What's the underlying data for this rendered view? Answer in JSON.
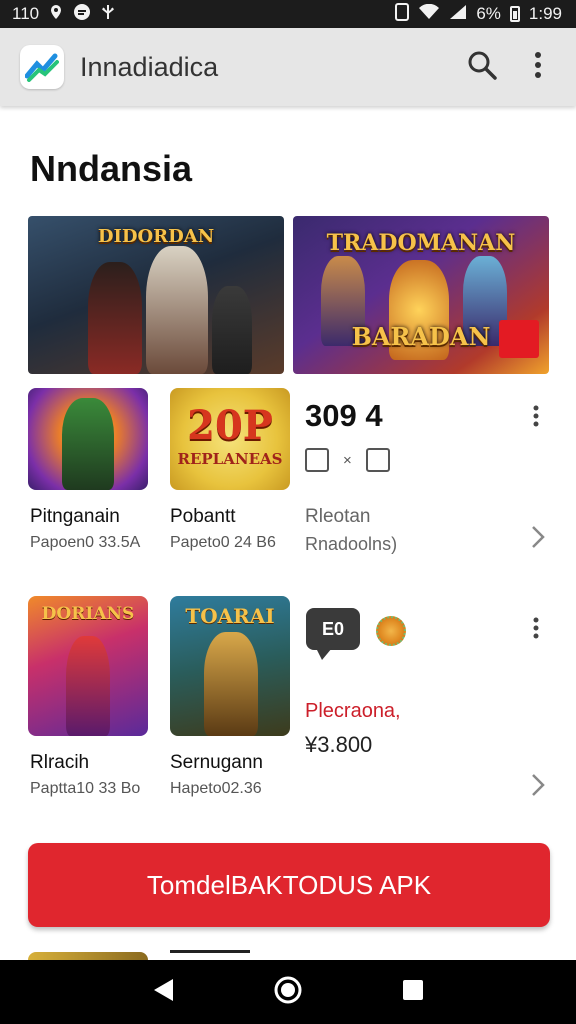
{
  "status_bar": {
    "time_left": "110",
    "signal_text": "6%",
    "clock": "1:99",
    "icons": [
      "location-icon",
      "app-notification-icon",
      "usb-icon",
      "sim-icon",
      "wifi-icon",
      "signal-icon",
      "battery-icon"
    ]
  },
  "app_bar": {
    "title": "Innadiadica",
    "actions": [
      "search-icon",
      "more-vert-icon"
    ]
  },
  "section": {
    "title": "Nndansia"
  },
  "banners": [
    {
      "title": "DIDORDAN"
    },
    {
      "title_top": "TRADOMANAN",
      "title_bottom": "BARADAN"
    }
  ],
  "row1": {
    "tiles": [
      {
        "name": "Pitnganain",
        "sub": "Papoen0 33.5A"
      },
      {
        "name": "Pobantt",
        "sub": "Papeto0 24 B6",
        "art_text_top": "20P",
        "art_text_bottom": "REPLANEAS"
      }
    ],
    "rating": "309 4",
    "mini_sep": "×",
    "info_title": "Rleotan",
    "info_sub": "Rnadoolns)"
  },
  "row2": {
    "tiles": [
      {
        "name": "Rlracih",
        "sub": "Paptta10 33 Bo",
        "art_text": "DORIANS"
      },
      {
        "name": "Sernugann",
        "sub": "Hapeto02.36",
        "art_text": "TOARAI"
      }
    ],
    "badge": "E0",
    "promo": "Plecraona,",
    "price": "¥3.800"
  },
  "download_button": {
    "label": "TomdelBAKTODUS APK"
  },
  "colors": {
    "accent_red": "#e0262e",
    "appbar": "#e6e6e6",
    "status_bar": "#1c1c1c",
    "nav_bar": "#000000"
  },
  "nav": [
    "back-icon",
    "home-icon",
    "recents-icon"
  ]
}
